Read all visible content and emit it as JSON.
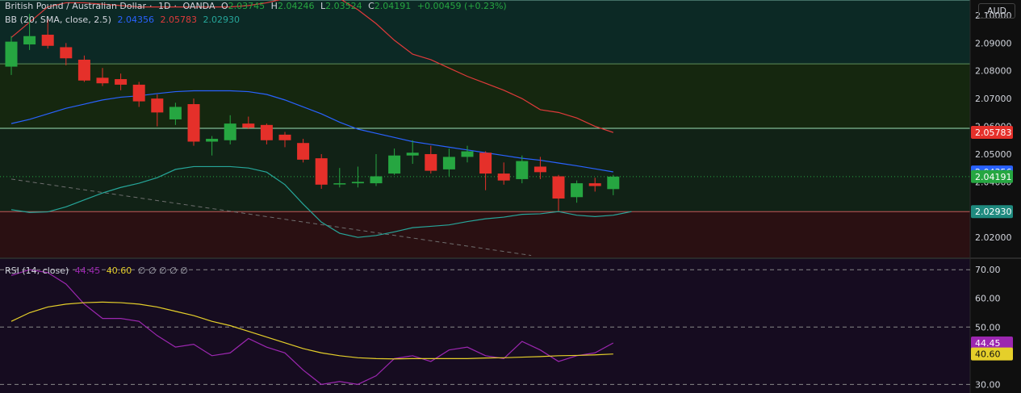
{
  "header": {
    "symbol": "British Pound / Australian Dollar",
    "interval": "1D",
    "source": "OANDA",
    "o_label": "O",
    "o_value": "2.03745",
    "h_label": "H",
    "h_value": "2.04246",
    "l_label": "L",
    "l_value": "2.03524",
    "c_label": "C",
    "c_value": "2.04191",
    "change": "+0.00459 (+0.23%)",
    "currency": "AUD"
  },
  "bb_legend": {
    "name": "BB (20, SMA, close, 2.5)",
    "basis": "2.04356",
    "upper": "2.05783",
    "lower": "2.02930"
  },
  "rsi_legend": {
    "name": "RSI (14, close)",
    "rsi": "44.45",
    "ma": "40.60",
    "extra": "∅ ∅ ∅ ∅ ∅"
  },
  "colors": {
    "up": "#26a641",
    "down": "#e5302a",
    "bb_basis": "#2962ff",
    "bb_upper": "#e03a3a",
    "bb_lower": "#26a69a",
    "rsi": "#9c27b0",
    "rsi_ma": "#e5cf2a",
    "hline": "#9be0b4"
  },
  "chart_data": [
    {
      "type": "candlestick",
      "yticks": [
        "2.10000",
        "2.09000",
        "2.08000",
        "2.07000",
        "2.06000",
        "2.05000",
        "2.04000",
        "2.03000",
        "2.02000"
      ],
      "ylim": [
        2.0125,
        2.1055
      ],
      "candles": [
        {
          "o": 2.0815,
          "h": 2.0925,
          "l": 2.0785,
          "c": 2.0905
        },
        {
          "o": 2.0895,
          "h": 2.1005,
          "l": 2.0875,
          "c": 2.0925
        },
        {
          "o": 2.093,
          "h": 2.0985,
          "l": 2.088,
          "c": 2.089
        },
        {
          "o": 2.0885,
          "h": 2.09,
          "l": 2.082,
          "c": 2.0845
        },
        {
          "o": 2.084,
          "h": 2.0855,
          "l": 2.076,
          "c": 2.0765
        },
        {
          "o": 2.0775,
          "h": 2.081,
          "l": 2.0745,
          "c": 2.0755
        },
        {
          "o": 2.077,
          "h": 2.079,
          "l": 2.073,
          "c": 2.075
        },
        {
          "o": 2.075,
          "h": 2.076,
          "l": 2.067,
          "c": 2.069
        },
        {
          "o": 2.07,
          "h": 2.0715,
          "l": 2.06,
          "c": 2.065
        },
        {
          "o": 2.0625,
          "h": 2.0685,
          "l": 2.0605,
          "c": 2.067
        },
        {
          "o": 2.068,
          "h": 2.07,
          "l": 2.053,
          "c": 2.0545
        },
        {
          "o": 2.0545,
          "h": 2.0565,
          "l": 2.0495,
          "c": 2.0555
        },
        {
          "o": 2.055,
          "h": 2.064,
          "l": 2.0535,
          "c": 2.061
        },
        {
          "o": 2.061,
          "h": 2.0635,
          "l": 2.059,
          "c": 2.0595
        },
        {
          "o": 2.0605,
          "h": 2.061,
          "l": 2.0535,
          "c": 2.055
        },
        {
          "o": 2.057,
          "h": 2.058,
          "l": 2.0525,
          "c": 2.055
        },
        {
          "o": 2.054,
          "h": 2.0555,
          "l": 2.047,
          "c": 2.048
        },
        {
          "o": 2.0485,
          "h": 2.05,
          "l": 2.0375,
          "c": 2.039
        },
        {
          "o": 2.0395,
          "h": 2.045,
          "l": 2.038,
          "c": 2.0395
        },
        {
          "o": 2.0395,
          "h": 2.0455,
          "l": 2.038,
          "c": 2.04
        },
        {
          "o": 2.0395,
          "h": 2.05,
          "l": 2.0385,
          "c": 2.042
        },
        {
          "o": 2.043,
          "h": 2.052,
          "l": 2.0425,
          "c": 2.0495
        },
        {
          "o": 2.0495,
          "h": 2.055,
          "l": 2.0465,
          "c": 2.0505
        },
        {
          "o": 2.05,
          "h": 2.053,
          "l": 2.043,
          "c": 2.044
        },
        {
          "o": 2.0445,
          "h": 2.052,
          "l": 2.042,
          "c": 2.049
        },
        {
          "o": 2.049,
          "h": 2.053,
          "l": 2.047,
          "c": 2.051
        },
        {
          "o": 2.0505,
          "h": 2.051,
          "l": 2.037,
          "c": 2.043
        },
        {
          "o": 2.043,
          "h": 2.047,
          "l": 2.039,
          "c": 2.0405
        },
        {
          "o": 2.041,
          "h": 2.0495,
          "l": 2.0395,
          "c": 2.0475
        },
        {
          "o": 2.0455,
          "h": 2.049,
          "l": 2.041,
          "c": 2.0435
        },
        {
          "o": 2.042,
          "h": 2.0425,
          "l": 2.0295,
          "c": 2.034
        },
        {
          "o": 2.0345,
          "h": 2.0405,
          "l": 2.0325,
          "c": 2.0395
        },
        {
          "o": 2.0395,
          "h": 2.0415,
          "l": 2.0365,
          "c": 2.0385
        },
        {
          "o": 2.0374,
          "h": 2.0425,
          "l": 2.0352,
          "c": 2.0419
        }
      ],
      "bb_upper": [
        2.092,
        2.0975,
        2.103,
        2.1045,
        2.1045,
        2.104,
        2.1035,
        2.103,
        2.103,
        2.103,
        2.103,
        2.103,
        2.103,
        2.1035,
        2.1045,
        2.106,
        2.107,
        2.107,
        2.106,
        2.102,
        2.097,
        2.091,
        2.086,
        2.084,
        2.081,
        2.078,
        2.0755,
        2.073,
        2.07,
        2.066,
        2.065,
        2.063,
        2.06,
        2.0578
      ],
      "bb_basis": [
        2.061,
        2.0625,
        2.0645,
        2.0665,
        2.068,
        2.0695,
        2.0705,
        2.071,
        2.0718,
        2.0725,
        2.0728,
        2.0728,
        2.0728,
        2.0725,
        2.0715,
        2.0695,
        2.067,
        2.0645,
        2.0615,
        2.059,
        2.0575,
        2.056,
        2.0545,
        2.0535,
        2.0525,
        2.0515,
        2.0505,
        2.0495,
        2.0485,
        2.0478,
        2.0468,
        2.0458,
        2.0447,
        2.0436
      ],
      "bb_lower": [
        2.03,
        2.029,
        2.0292,
        2.031,
        2.0335,
        2.036,
        2.038,
        2.0395,
        2.0415,
        2.0445,
        2.0455,
        2.0455,
        2.0455,
        2.045,
        2.0435,
        2.039,
        2.032,
        2.0255,
        2.0215,
        2.02,
        2.0207,
        2.022,
        2.0235,
        2.024,
        2.0245,
        2.0257,
        2.0267,
        2.0273,
        2.0283,
        2.0285,
        2.0293,
        2.028,
        2.0275,
        2.028,
        2.0293
      ],
      "hlines": [
        2.1055,
        2.0825,
        2.0593,
        2.0293
      ],
      "trendline": {
        "from": [
          0,
          2.041
        ],
        "to": [
          28.5,
          2.0135
        ]
      }
    },
    {
      "type": "line",
      "yticks": [
        "70.00",
        "60.00",
        "50.00",
        "30.00"
      ],
      "ylim": [
        27,
        74
      ],
      "levels": [
        70,
        50,
        30
      ],
      "rsi": [
        68,
        70,
        69,
        65,
        58,
        53,
        53,
        52,
        47,
        43,
        44,
        40,
        41,
        46,
        43,
        41,
        35,
        30,
        31,
        30,
        33,
        39,
        40,
        38,
        42,
        43,
        40,
        39,
        45,
        42,
        38,
        40,
        41,
        44.45
      ],
      "rsi_ma": [
        52,
        55,
        57,
        58,
        58.5,
        58.7,
        58.5,
        58,
        57,
        55.5,
        54,
        52,
        50.5,
        48.5,
        46.5,
        44.5,
        42.5,
        41,
        40,
        39.3,
        39,
        38.9,
        39,
        39,
        39,
        39,
        39.2,
        39.3,
        39.5,
        39.7,
        40,
        40.1,
        40.3,
        40.6
      ]
    }
  ]
}
